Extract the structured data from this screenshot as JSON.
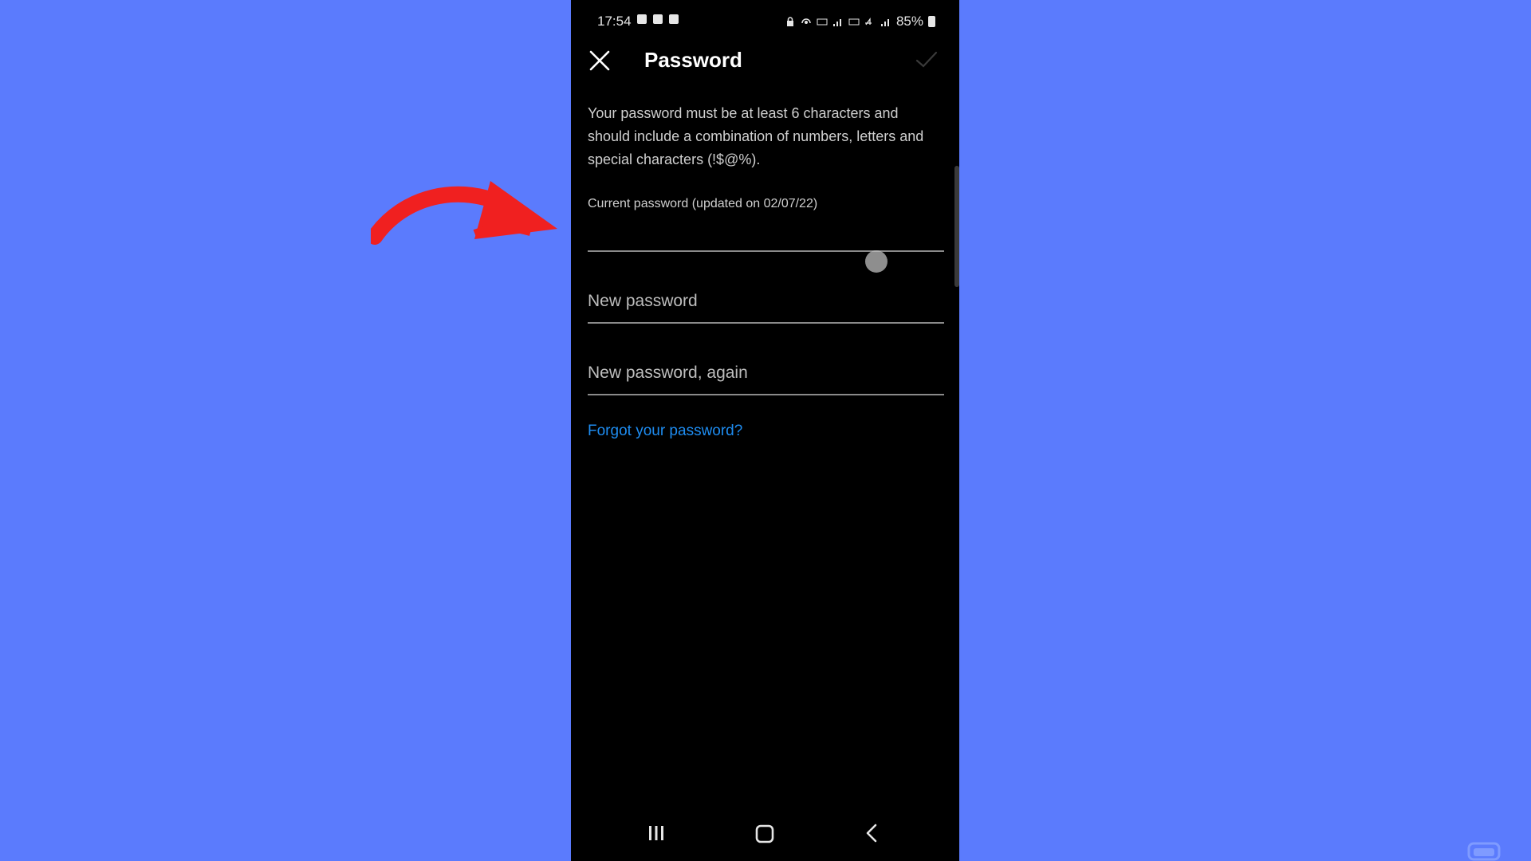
{
  "status_bar": {
    "time": "17:54",
    "battery": "85%"
  },
  "header": {
    "title": "Password",
    "close_icon": "close-icon",
    "confirm_icon": "checkmark-icon"
  },
  "description": "Your password must be at least 6 characters and should include a combination of numbers, letters and special characters (!$@%).",
  "fields": {
    "current_label": "Current password (updated on 02/07/22)",
    "current_value": "",
    "new_placeholder": "New password",
    "new_value": "",
    "again_placeholder": "New password, again",
    "again_value": ""
  },
  "forgot_link": "Forgot your password?",
  "colors": {
    "background": "#5b7bfd",
    "phone": "#000000",
    "link": "#1e8cf0",
    "arrow": "#f02020"
  },
  "annotation": {
    "arrow_icon": "red-curved-arrow-icon"
  }
}
